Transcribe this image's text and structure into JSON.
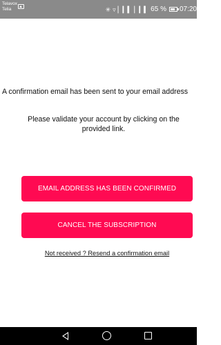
{
  "status_bar": {
    "carrier_line1": "Telavox",
    "carrier_line2": "Telia",
    "battery": "65 %",
    "time": "07:20",
    "icons": [
      "gallery-icon",
      "bluetooth-icon",
      "wifi-icon",
      "signal-icon",
      "signal-icon",
      "battery-icon"
    ]
  },
  "main": {
    "confirmation_text": "A confirmation email has been sent to your email address",
    "validate_text": "Please validate your account by clicking on the provided link.",
    "confirm_button_label": "EMAIL ADDRESS HAS BEEN CONFIRMED",
    "cancel_button_label": "CANCEL THE SUBSCRIPTION",
    "resend_link_text": "Not received ? Resend a confirmation email",
    "accent_color": "#ff0a52"
  },
  "nav_bar": {
    "icons": [
      "back-icon",
      "home-icon",
      "recents-icon"
    ]
  }
}
